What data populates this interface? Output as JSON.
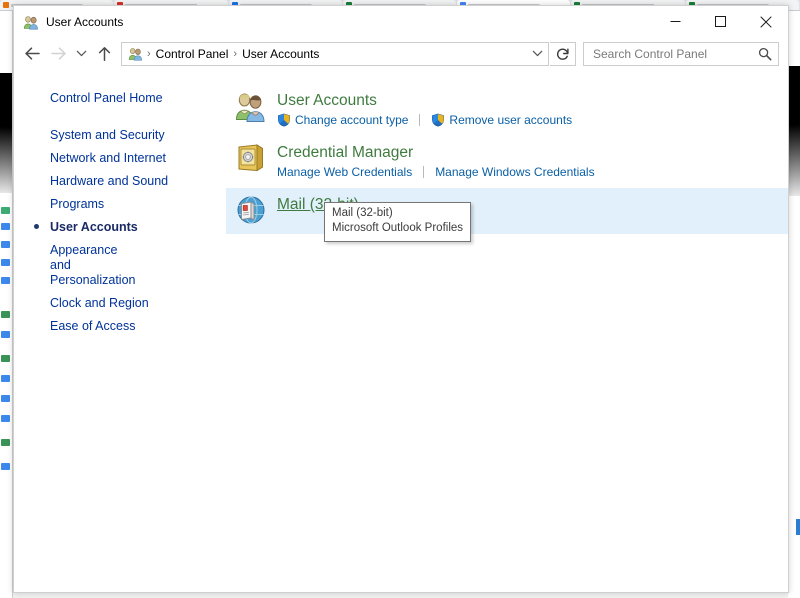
{
  "window": {
    "title": "User Accounts",
    "title_icon": "user-accounts-icon",
    "controls": {
      "minimize": "Minimize",
      "maximize": "Maximize",
      "close": "Close"
    }
  },
  "navbar": {
    "back": "Back",
    "forward": "Forward",
    "recent": "Recent locations",
    "up": "Up",
    "breadcrumb": [
      "Control Panel",
      "User Accounts"
    ],
    "breadcrumb_separator": "›",
    "dropdown_icon": "chevron-down-icon",
    "refresh_icon": "refresh-icon",
    "refresh_label": "Refresh"
  },
  "search": {
    "placeholder": "Search Control Panel",
    "value": "",
    "icon": "search-icon"
  },
  "sidebar": {
    "home": "Control Panel Home",
    "items": [
      {
        "label": "System and Security",
        "current": false
      },
      {
        "label": "Network and Internet",
        "current": false
      },
      {
        "label": "Hardware and Sound",
        "current": false
      },
      {
        "label": "Programs",
        "current": false
      },
      {
        "label": "User Accounts",
        "current": true
      },
      {
        "label": "Appearance and Personalization",
        "current": false
      },
      {
        "label": "Clock and Region",
        "current": false
      },
      {
        "label": "Ease of Access",
        "current": false
      }
    ]
  },
  "content": {
    "categories": [
      {
        "title": "User Accounts",
        "icon": "user-accounts-icon",
        "highlighted": false,
        "hovered": false,
        "links": [
          {
            "label": "Change account type",
            "shield": true
          },
          {
            "label": "Remove user accounts",
            "shield": true
          }
        ]
      },
      {
        "title": "Credential Manager",
        "icon": "credential-vault-icon",
        "highlighted": false,
        "hovered": false,
        "links": [
          {
            "label": "Manage Web Credentials",
            "shield": false
          },
          {
            "label": "Manage Windows Credentials",
            "shield": false
          }
        ]
      },
      {
        "title": "Mail (32-bit)",
        "icon": "mail-globe-icon",
        "highlighted": true,
        "hovered": true,
        "links": []
      }
    ]
  },
  "tooltip": {
    "visible": true,
    "line1": "Mail (32-bit)",
    "line2": "Microsoft Outlook Profiles"
  },
  "colors": {
    "category_title_green": "#3f7b3f",
    "link_blue": "#0a5fa5",
    "sidebar_blue": "#003399",
    "highlight_row": "#e2f0fb",
    "close_hover_red": "#e81123",
    "window_border": "#d0d0d0"
  }
}
